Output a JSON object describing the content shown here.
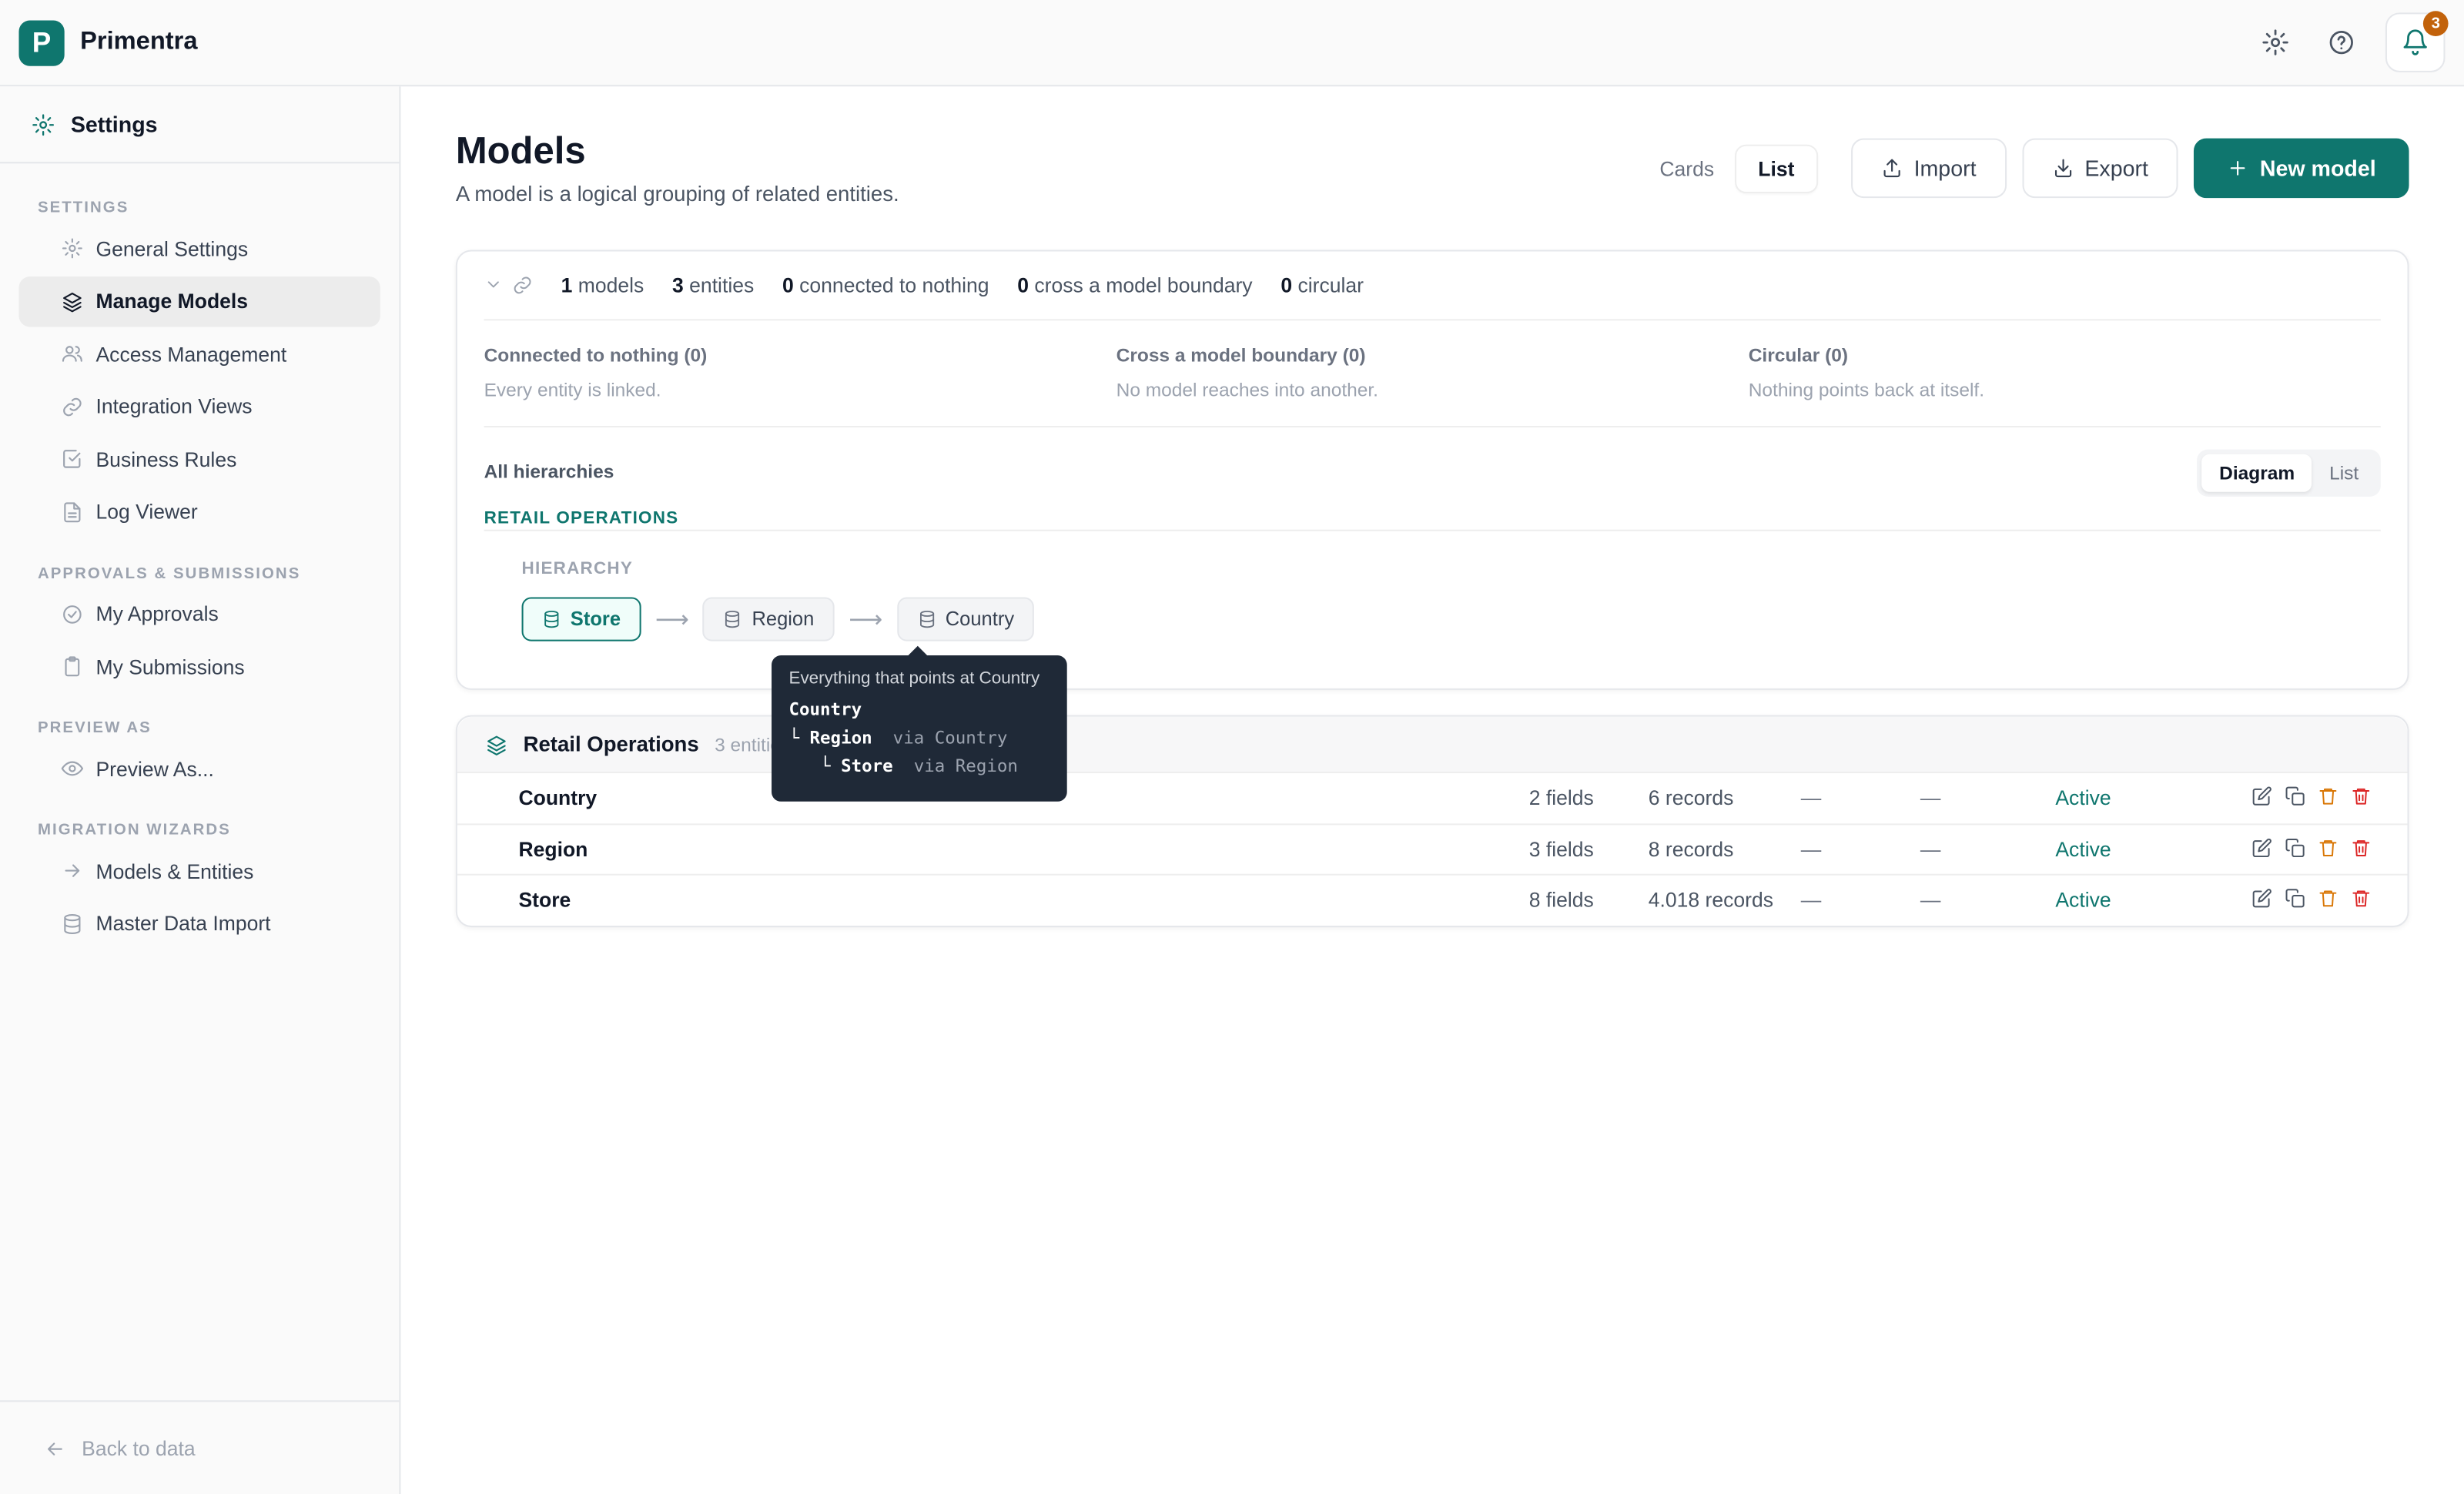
{
  "app": {
    "brand": "Primentra",
    "logo_letter": "P",
    "notification_count": "3"
  },
  "sidebar": {
    "header": "Settings",
    "sections": [
      {
        "label": "SETTINGS",
        "items": [
          {
            "label": "General Settings",
            "icon": "gear-icon"
          },
          {
            "label": "Manage Models",
            "icon": "layers-icon",
            "active": true
          },
          {
            "label": "Access Management",
            "icon": "users-icon"
          },
          {
            "label": "Integration Views",
            "icon": "link-icon"
          },
          {
            "label": "Business Rules",
            "icon": "check-square-icon"
          },
          {
            "label": "Log Viewer",
            "icon": "file-text-icon"
          }
        ]
      },
      {
        "label": "APPROVALS & SUBMISSIONS",
        "items": [
          {
            "label": "My Approvals",
            "icon": "check-circle-icon"
          },
          {
            "label": "My Submissions",
            "icon": "clipboard-icon"
          }
        ]
      },
      {
        "label": "PREVIEW AS",
        "items": [
          {
            "label": "Preview As...",
            "icon": "eye-icon"
          }
        ]
      },
      {
        "label": "MIGRATION WIZARDS",
        "items": [
          {
            "label": "Models & Entities",
            "icon": "arrow-right-icon"
          },
          {
            "label": "Master Data Import",
            "icon": "database-icon"
          }
        ]
      }
    ],
    "footer": "Back to data"
  },
  "page": {
    "title": "Models",
    "subtitle": "A model is a logical grouping of related entities."
  },
  "toolbar": {
    "cards": "Cards",
    "list": "List",
    "import": "Import",
    "export": "Export",
    "new_model": "New model"
  },
  "summary": {
    "models_n": "1",
    "models_label": "models",
    "entities_n": "3",
    "entities_label": "entities",
    "nothing_n": "0",
    "nothing_label": "connected to nothing",
    "cross_n": "0",
    "cross_label": "cross a model boundary",
    "circular_n": "0",
    "circular_label": "circular"
  },
  "checks": [
    {
      "title": "Connected to nothing (0)",
      "desc": "Every entity is linked."
    },
    {
      "title": "Cross a model boundary (0)",
      "desc": "No model reaches into another."
    },
    {
      "title": "Circular (0)",
      "desc": "Nothing points back at itself."
    }
  ],
  "hierarchies": {
    "label": "All hierarchies",
    "view_diagram": "Diagram",
    "view_list": "List",
    "group": "RETAIL OPERATIONS",
    "hierarchy_label": "HIERARCHY",
    "chain": [
      "Store",
      "Region",
      "Country"
    ]
  },
  "tooltip": {
    "title": "Everything that points at Country",
    "root": "Country",
    "l1_name": "Region",
    "l1_via": "via Country",
    "l2_name": "Store",
    "l2_via": "via Region"
  },
  "model": {
    "name": "Retail Operations",
    "count": "3 entities",
    "rows": [
      {
        "name": "Country",
        "fields": "2 fields",
        "records": "6 records",
        "c1": "—",
        "c2": "—",
        "status": "Active"
      },
      {
        "name": "Region",
        "fields": "3 fields",
        "records": "8 records",
        "c1": "—",
        "c2": "—",
        "status": "Active"
      },
      {
        "name": "Store",
        "fields": "8 fields",
        "records": "4.018 records",
        "c1": "—",
        "c2": "—",
        "status": "Active"
      }
    ]
  },
  "colors": {
    "accent": "#0f766e",
    "badge": "#c2620b",
    "warn": "#d97706",
    "danger": "#dc2626"
  }
}
